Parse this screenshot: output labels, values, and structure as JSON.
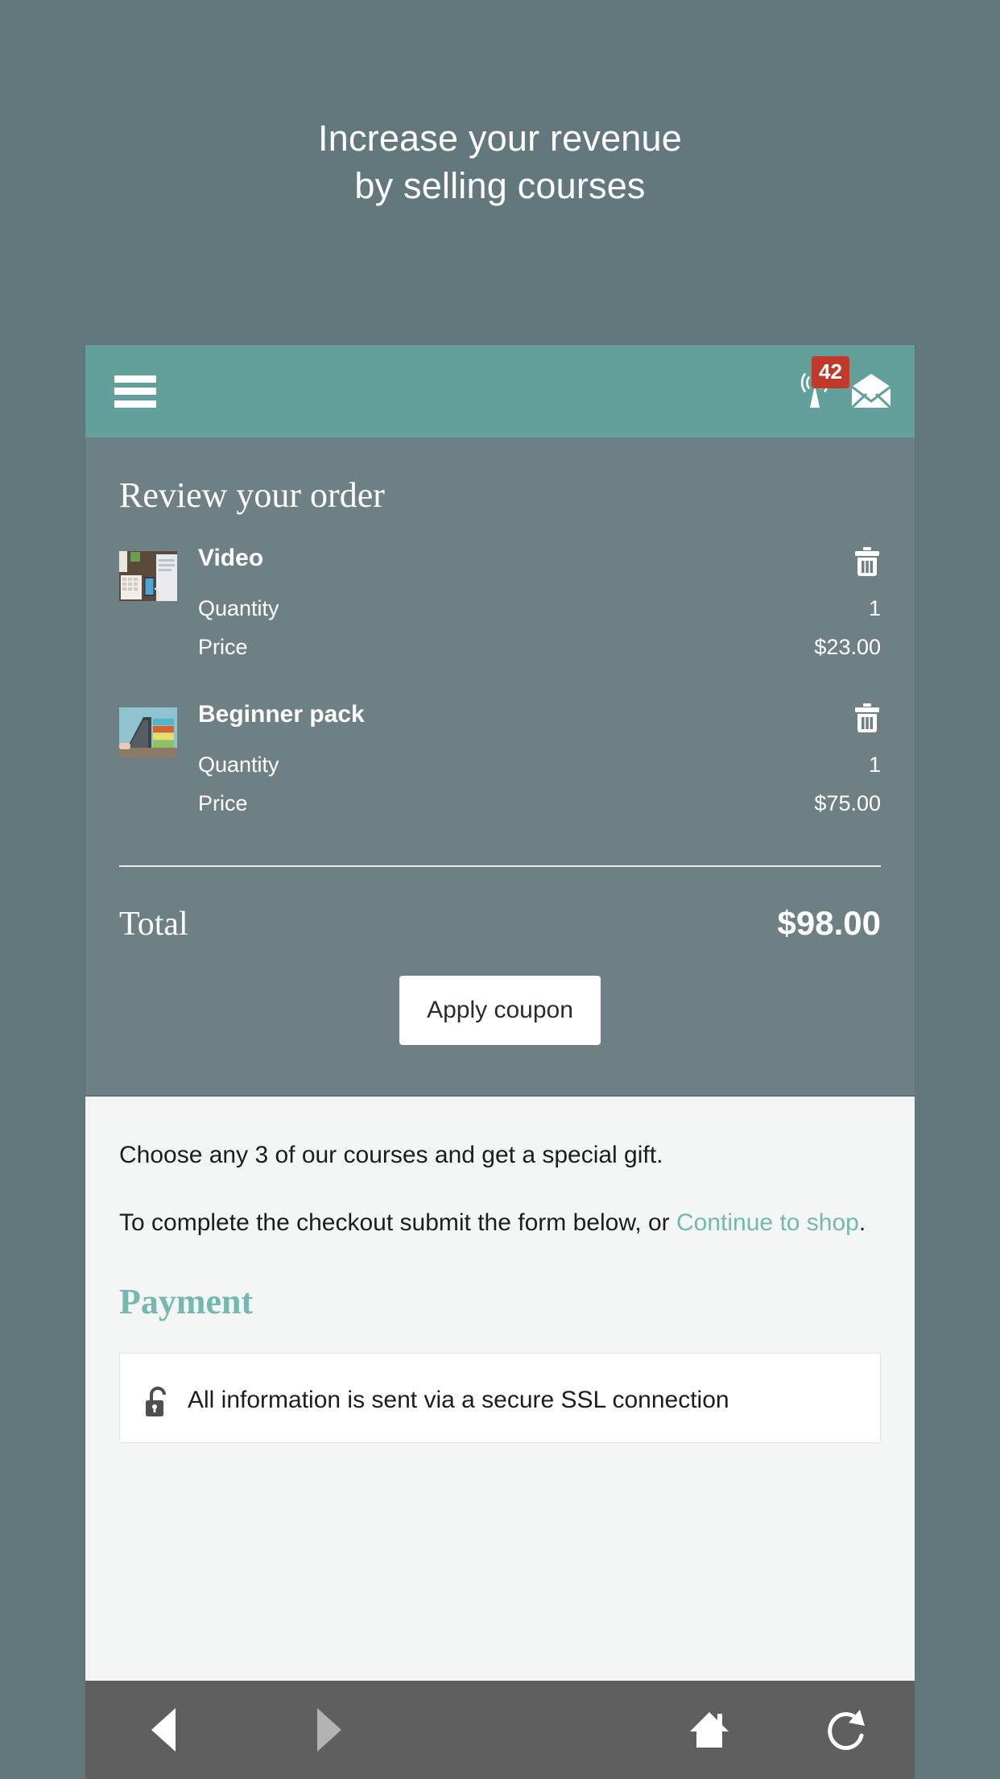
{
  "promo": {
    "title_line1": "Increase your revenue",
    "title_line2": "by selling courses"
  },
  "appbar": {
    "menu_icon": "hamburger-menu-icon",
    "broadcast_icon": "broadcast-tower-icon",
    "badge_count": "42",
    "mail_icon": "envelope-icon",
    "background_color": "#63a09b"
  },
  "order": {
    "heading": "Review your order",
    "quantity_label": "Quantity",
    "price_label": "Price",
    "delete_icon": "trash-icon",
    "items": [
      {
        "name": "Video",
        "quantity": "1",
        "price": "$23.00",
        "thumbnail": "desk-with-keyboard-and-phone-photo"
      },
      {
        "name": "Beginner pack",
        "quantity": "1",
        "price": "$75.00",
        "thumbnail": "laptop-with-stacked-books-photo"
      }
    ],
    "total_label": "Total",
    "total_value": "$98.00",
    "coupon_button": "Apply coupon",
    "panel_color": "#6e8084"
  },
  "content": {
    "paragraph1": "Choose any 3 of our courses and get a special gift.",
    "paragraph2_prefix": "To complete the checkout submit the form below, or ",
    "link_label": "Continue to shop",
    "paragraph2_suffix": ".",
    "payment_heading": "Payment",
    "ssl_icon": "unlocked-padlock-icon",
    "ssl_text": "All information is sent via a secure SSL connection",
    "accent_color": "#74b8b0"
  },
  "bottomnav": {
    "back_icon": "back-arrow-icon",
    "forward_icon": "forward-arrow-icon",
    "home_icon": "home-icon",
    "reload_icon": "reload-icon",
    "background_color": "#5f5f5f"
  }
}
